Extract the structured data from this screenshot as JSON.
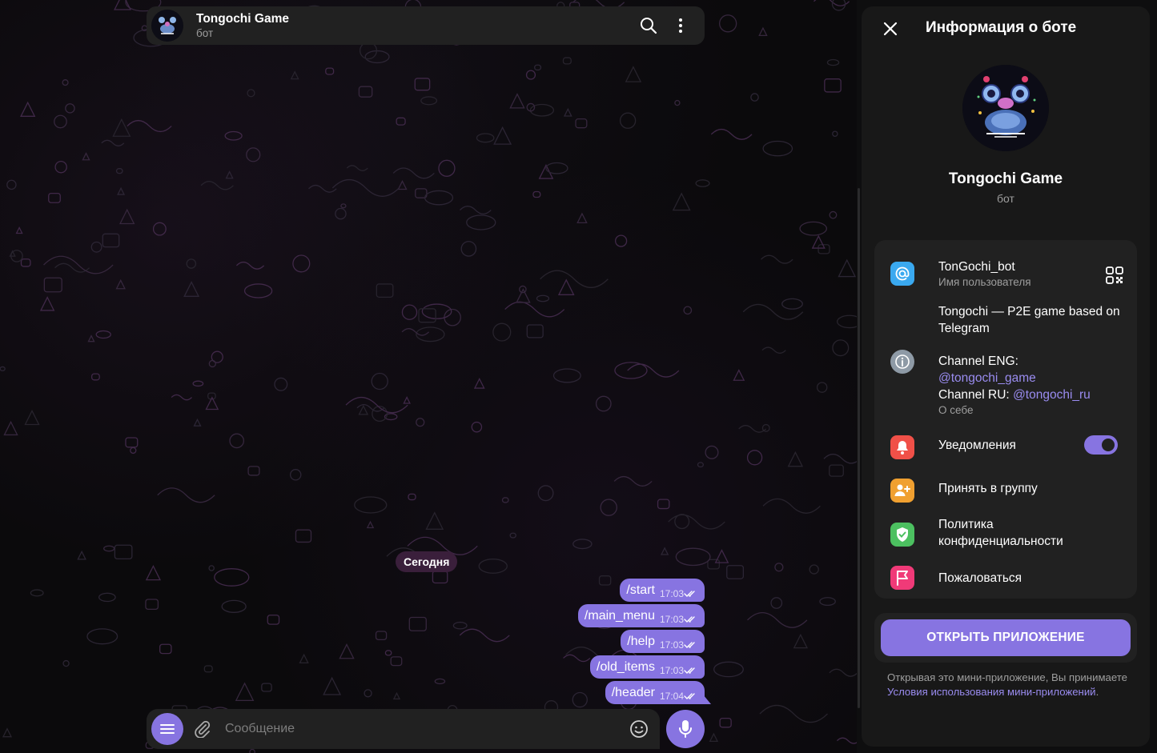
{
  "chat": {
    "title": "Tongochi Game",
    "subtitle": "бот",
    "date_label": "Сегодня",
    "messages": [
      {
        "text": "/start",
        "time": "17:03"
      },
      {
        "text": "/main_menu",
        "time": "17:03"
      },
      {
        "text": "/help",
        "time": "17:03"
      },
      {
        "text": "/old_items",
        "time": "17:03"
      },
      {
        "text": "/header",
        "time": "17:04"
      }
    ],
    "composer_placeholder": "Сообщение"
  },
  "panel": {
    "title": "Информация о боте",
    "bot_name": "Tongochi Game",
    "bot_type": "бот",
    "username": "TonGochi_bot",
    "username_label": "Имя пользователя",
    "description": "Tongochi — P2E game based on Telegram",
    "bio_line1_prefix": "Channel ENG:",
    "bio_line1_link": "@tongochi_game",
    "bio_line2_prefix": "Channel RU:",
    "bio_line2_link": "@tongochi_ru",
    "bio_label": "О себе",
    "notifications_label": "Уведомления",
    "notifications_on": true,
    "add_to_group_label": "Принять в группу",
    "privacy_label_line1": "Политика",
    "privacy_label_line2": "конфиденциальности",
    "report_label": "Пожаловаться",
    "open_app_label": "Открыть приложение",
    "note_prefix": "Открывая это мини-приложение, Вы принимаете",
    "note_link": "Условия использования мини-приложений",
    "note_suffix": "."
  },
  "colors": {
    "accent": "#8774e1",
    "background": "#0b0a0c",
    "panel": "#181818",
    "card": "#212121",
    "icon_username": "#3aa9f0",
    "icon_info": "#8e9aa6",
    "icon_notifications": "#f05048",
    "icon_group": "#f0a030",
    "icon_privacy": "#4cc060",
    "icon_report": "#f03a78"
  },
  "icons": {
    "search": "search-icon",
    "more": "more-vertical-icon",
    "close": "close-icon",
    "qr": "qr-code-icon",
    "menu": "menu-icon",
    "attach": "paperclip-icon",
    "emoji": "smile-icon",
    "mic": "microphone-icon",
    "check": "double-check-icon"
  }
}
